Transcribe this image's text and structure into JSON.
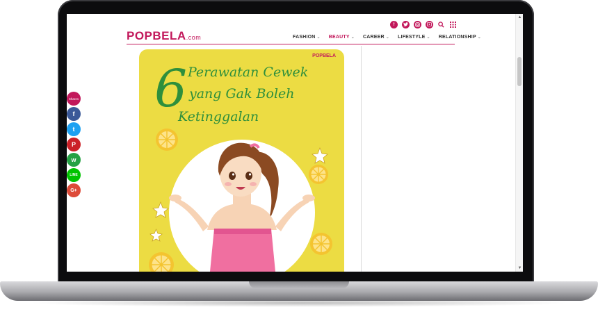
{
  "site": {
    "logo": "POPBELA",
    "logo_suffix": ".com",
    "brand_color": "#c2185b"
  },
  "social_icons": [
    "facebook-icon",
    "twitter-icon",
    "instagram-icon",
    "youtube-icon"
  ],
  "utility_icons": [
    "search-icon",
    "grid-menu-icon"
  ],
  "nav": [
    {
      "label": "FASHION",
      "active": false
    },
    {
      "label": "BEAUTY",
      "active": true
    },
    {
      "label": "CAREER",
      "active": false
    },
    {
      "label": "LIFESTYLE",
      "active": false
    },
    {
      "label": "RELATIONSHIP",
      "active": false
    }
  ],
  "share": {
    "label": "Shares",
    "buttons": [
      {
        "name": "facebook",
        "glyph": "f",
        "color": "#3b5998"
      },
      {
        "name": "twitter",
        "glyph": "t",
        "color": "#1da1f2"
      },
      {
        "name": "pinterest",
        "glyph": "P",
        "color": "#cb2027"
      },
      {
        "name": "whatsapp",
        "glyph": "w",
        "color": "#25a244"
      },
      {
        "name": "line",
        "glyph": "LINE",
        "color": "#00c300"
      },
      {
        "name": "google-plus",
        "glyph": "G+",
        "color": "#dd4b39"
      }
    ]
  },
  "article_image": {
    "brand": "POPBELA",
    "number": "6",
    "title_lines": [
      "Perawatan Cewek",
      "yang Gak Boleh",
      "Ketinggalan"
    ],
    "background": "#ecdc43",
    "text_color": "#2e8f3c"
  }
}
